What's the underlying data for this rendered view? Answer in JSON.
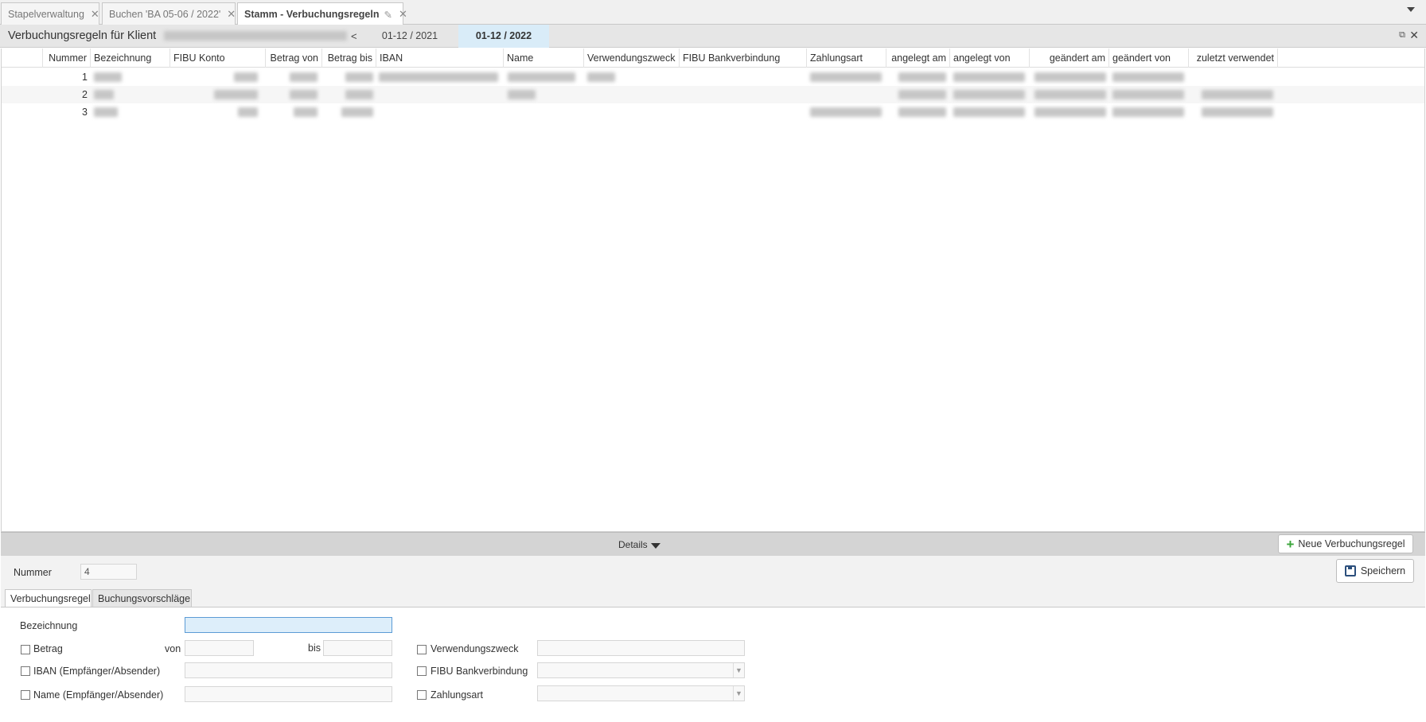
{
  "tabs": [
    {
      "label": "Stapelverwaltung",
      "active": false
    },
    {
      "label": "Buchen 'BA 05-06 / 2022'",
      "active": false
    },
    {
      "label": "Stamm - Verbuchungsregeln",
      "active": true
    }
  ],
  "header": {
    "title": "Verbuchungsregeln für Klient",
    "prev": "<",
    "years": [
      "01-12 / 2021",
      "01-12 / 2022"
    ],
    "selected_year": "01-12 / 2022"
  },
  "grid": {
    "columns": [
      "Nummer",
      "Bezeichnung",
      "FIBU Konto",
      "Betrag von",
      "Betrag bis",
      "IBAN",
      "Name",
      "Verwendungszweck",
      "FIBU Bankverbindung",
      "Zahlungsart",
      "angelegt am",
      "angelegt von",
      "geändert am",
      "geändert von",
      "zuletzt verwendet"
    ],
    "rows": [
      {
        "nummer": "1"
      },
      {
        "nummer": "2"
      },
      {
        "nummer": "3"
      }
    ]
  },
  "details": {
    "label": "Details",
    "new_rule_button": "Neue Verbuchungsregel",
    "save_button": "Speichern",
    "nummer_label": "Nummer",
    "nummer_value": "4",
    "subtabs": [
      "Verbuchungsregel",
      "Buchungsvorschläge"
    ],
    "form": {
      "bezeichnung_label": "Bezeichnung",
      "betrag_label": "Betrag",
      "von_label": "von",
      "bis_label": "bis",
      "iban_label": "IBAN (Empfänger/Absender)",
      "name_label": "Name (Empfänger/Absender)",
      "verwendungszweck_label": "Verwendungszweck",
      "fibu_bank_label": "FIBU Bankverbindung",
      "zahlungsart_label": "Zahlungsart"
    }
  },
  "colors": {
    "selected_year_bg": "#d9ecf8",
    "focus_input_bg": "#ddeefa",
    "plus_icon": "#3aa53a"
  }
}
